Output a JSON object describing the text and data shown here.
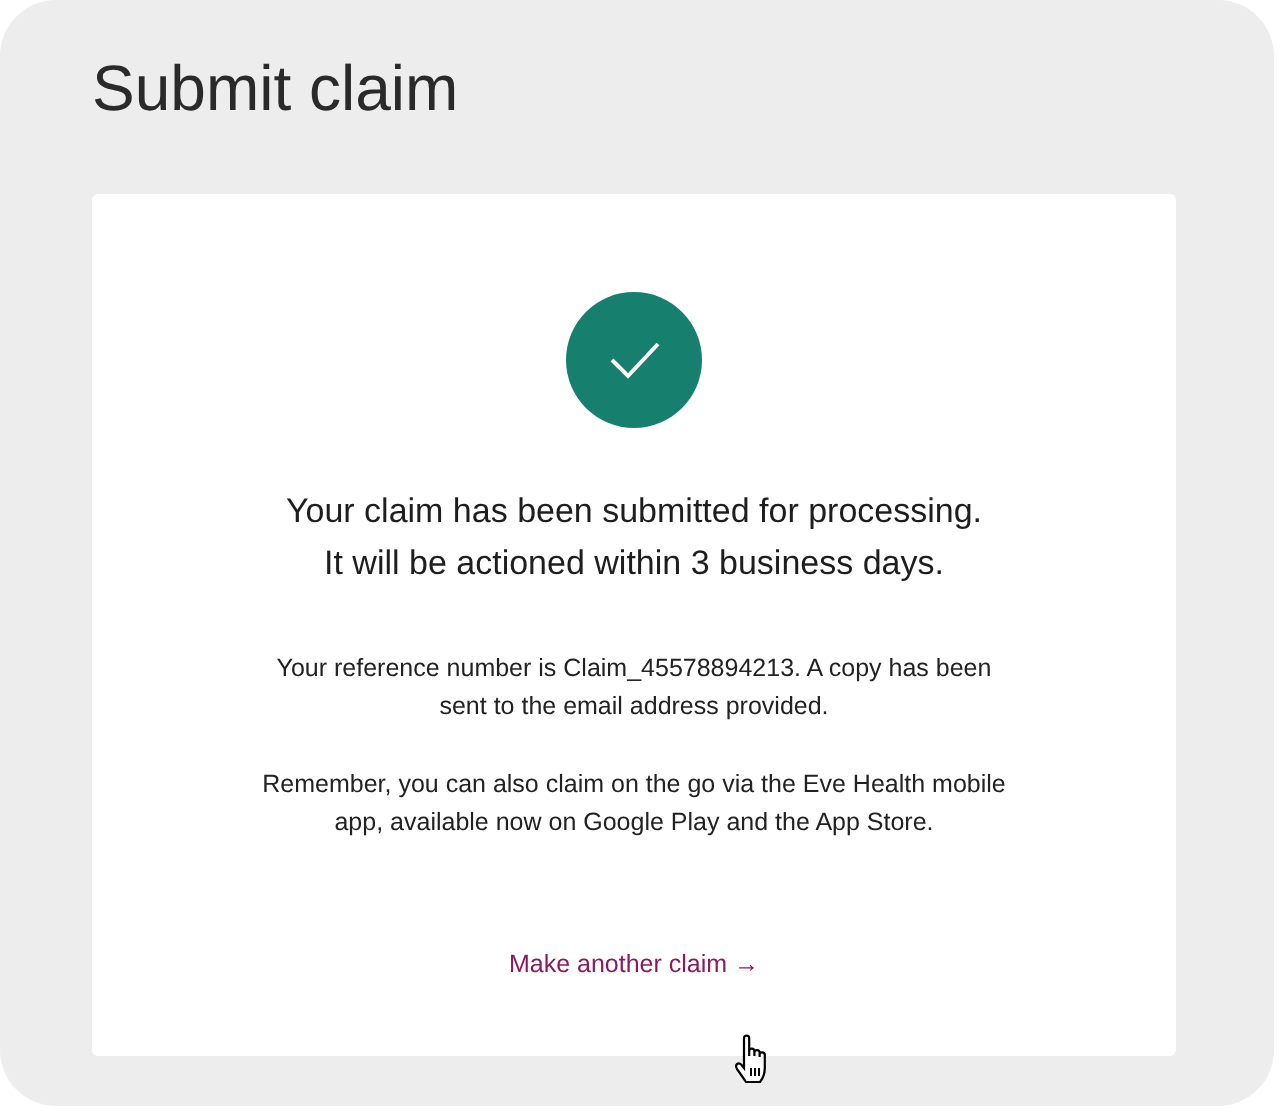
{
  "page": {
    "title": "Submit claim"
  },
  "confirmation": {
    "heading": [
      "Your claim has been submitted for processing.",
      "It will be actioned within 3 business days."
    ],
    "paragraphs": [
      "Your reference number is Claim_45578894213. A copy has been sent to the email address provided.",
      "Remember, you can also claim on the go via the Eve Health mobile app, available now on Google Play and the App Store."
    ],
    "link": {
      "label": "Make another claim →"
    }
  }
}
